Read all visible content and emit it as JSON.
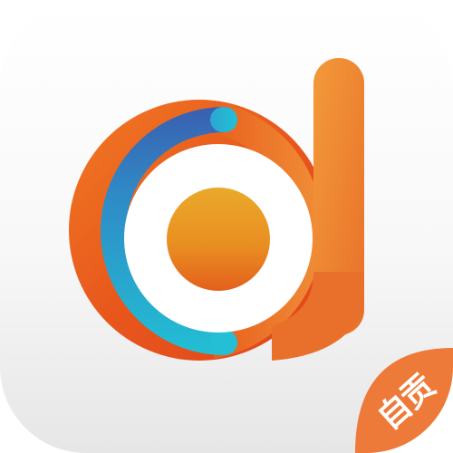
{
  "app_icon": {
    "icon_name": "brand-d-logo-icon",
    "badge": {
      "text": "自贡",
      "color": "#ee7a3a"
    },
    "colors": {
      "background_top": "#ffffff",
      "background_bottom": "#e9e9e9",
      "ring_orange_light": "#f28a2e",
      "ring_orange_dark": "#e14f1a",
      "arc_teal": "#25b7cf",
      "arc_blue": "#3f63b4",
      "center_gold": "#eaa628",
      "center_orange": "#e86a1c"
    }
  }
}
